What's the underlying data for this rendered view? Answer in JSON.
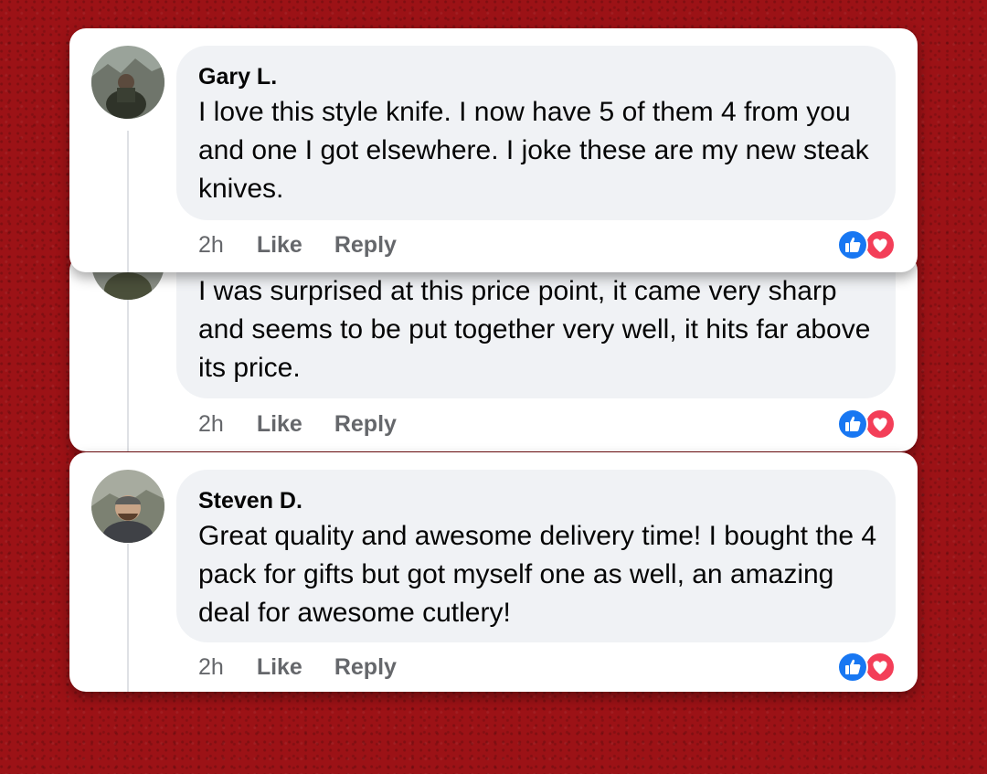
{
  "comments": [
    {
      "author": "Gary L.",
      "text": "I love this style knife. I now have 5 of them 4 from you and one I got elsewhere. I joke these are my new steak knives.",
      "time": "2h",
      "like_label": "Like",
      "reply_label": "Reply",
      "reactions": [
        "thumbs-up-icon",
        "heart-icon"
      ]
    },
    {
      "author": "",
      "text": "I was surprised at this price point, it came very sharp and seems to be put together very well, it hits far above its price.",
      "time": "2h",
      "like_label": "Like",
      "reply_label": "Reply",
      "reactions": [
        "thumbs-up-icon",
        "heart-icon"
      ]
    },
    {
      "author": "Steven D.",
      "text": "Great quality and awesome delivery time! I bought the 4 pack for gifts but got myself one as well, an amazing deal for awesome cutlery!",
      "time": "2h",
      "like_label": "Like",
      "reply_label": "Reply",
      "reactions": [
        "thumbs-up-icon",
        "heart-icon"
      ]
    }
  ],
  "colors": {
    "background": "#9c1216",
    "bubble": "#f0f2f5",
    "meta_text": "#65676b",
    "like_blue": "#1877f2",
    "love_red": "#f33e58"
  }
}
